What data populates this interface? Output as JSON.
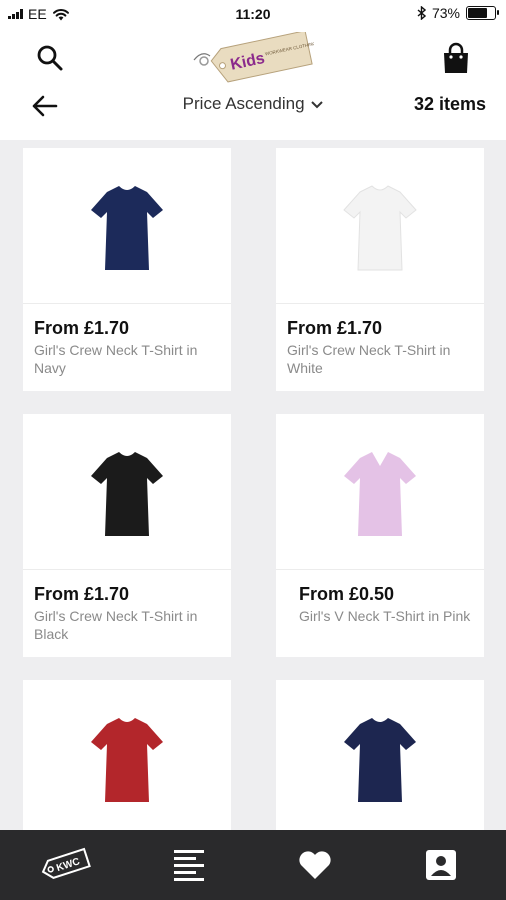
{
  "status_bar": {
    "carrier": "EE",
    "time": "11:20",
    "battery": "73%",
    "battery_level": 0.73
  },
  "header": {
    "logo_text": "Kids",
    "logo_subtext": "WORKWEAR CLOTHING",
    "sort_label": "Price Ascending",
    "item_count": "32 items"
  },
  "products": [
    {
      "price": "From £1.70",
      "name": "Girl's Crew Neck T-Shirt in Navy",
      "color": "#1c2a5a"
    },
    {
      "price": "From £1.70",
      "name": "Girl's Crew Neck T-Shirt in White",
      "color": "#f3f3f3"
    },
    {
      "price": "From £1.70",
      "name": "Girl's Crew Neck T-Shirt in Black",
      "color": "#1b1b1b"
    },
    {
      "price": "From £0.50",
      "name": "Girl's V Neck T-Shirt in Pink",
      "color": "#e4c2e6"
    },
    {
      "color": "#b3262b"
    },
    {
      "color": "#1d2650"
    }
  ],
  "tabbar": {
    "tabs": [
      {
        "icon": "kwc-tag-icon",
        "label": "KWC"
      },
      {
        "icon": "list-icon"
      },
      {
        "icon": "heart-icon"
      },
      {
        "icon": "account-icon"
      }
    ]
  }
}
